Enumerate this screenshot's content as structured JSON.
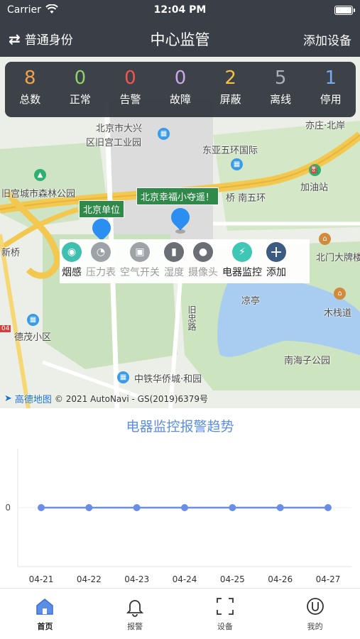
{
  "status_bar": {
    "carrier": "Carrier",
    "time": "12:04 PM"
  },
  "nav": {
    "left_label": "普通身份",
    "title": "中心监管",
    "right_label": "添加设备"
  },
  "stats": [
    {
      "value": "8",
      "label": "总数",
      "color": "#f0a24a"
    },
    {
      "value": "0",
      "label": "正常",
      "color": "#8fd16a"
    },
    {
      "value": "0",
      "label": "告警",
      "color": "#f2554d"
    },
    {
      "value": "0",
      "label": "故障",
      "color": "#c9a8e6"
    },
    {
      "value": "2",
      "label": "屏蔽",
      "color": "#f2c347"
    },
    {
      "value": "5",
      "label": "离线",
      "color": "#aab0b8"
    },
    {
      "value": "1",
      "label": "停用",
      "color": "#7aa9f2"
    }
  ],
  "map": {
    "labels": {
      "daxing": "北京市大兴",
      "jiugong": "区旧宫工业园",
      "yizhuang": "亦庄·北岸",
      "dongya": "东亚五环国际",
      "gucheng": "旧宫城市森林公园",
      "nanwu": "桥  南五环",
      "jiayouzhan": "加油站",
      "xinqiao": "新桥",
      "beimen": "北门大牌楼",
      "liangting": "凉亭",
      "muzhandao": "木栈道",
      "demao": "德茂小区",
      "nanhaizi": "南海子公园",
      "zhongtie": "中铁华侨城·和园",
      "jiuzhong": "旧忠路",
      "road_tag": "04"
    },
    "markers": [
      {
        "label": "北京单位"
      },
      {
        "label": "北京幸福小夺遥！"
      }
    ],
    "footer_logo": "高德地图",
    "footer_text": "© 2021 AutoNavi - GS(2019)6379号"
  },
  "categories": [
    {
      "label": "烟感",
      "icon": "smoke-detector-icon",
      "color": "#3fbfb0",
      "active": true
    },
    {
      "label": "压力表",
      "icon": "pressure-gauge-icon",
      "color": "#9ea3a8",
      "active": false
    },
    {
      "label": "空气开关",
      "icon": "air-switch-icon",
      "color": "#9ea3a8",
      "active": false
    },
    {
      "label": "湿度",
      "icon": "humidity-icon",
      "color": "#6b6f75",
      "active": false
    },
    {
      "label": "摄像头",
      "icon": "camera-icon",
      "color": "#6b6f75",
      "active": false
    },
    {
      "label": "电器监控",
      "icon": "lightning-icon",
      "color": "#3fc7b5",
      "active": true
    },
    {
      "label": "添加",
      "icon": "plus-icon",
      "color": "#3d5a80",
      "active": true
    }
  ],
  "chart_data": {
    "type": "line",
    "title": "电器监控报警趋势",
    "categories": [
      "04-21",
      "04-22",
      "04-23",
      "04-24",
      "04-25",
      "04-26",
      "04-27"
    ],
    "series": [
      {
        "values": [
          0,
          0,
          0,
          0,
          0,
          0,
          0
        ]
      }
    ],
    "yticks": [
      "0"
    ],
    "color": "#6a8ee6",
    "grid": true
  },
  "tabs": [
    {
      "label": "首页",
      "icon": "home-icon",
      "active": true
    },
    {
      "label": "报警",
      "icon": "bell-icon",
      "active": false
    },
    {
      "label": "设备",
      "icon": "scan-icon",
      "active": false
    },
    {
      "label": "我的",
      "icon": "profile-icon",
      "active": false
    }
  ]
}
